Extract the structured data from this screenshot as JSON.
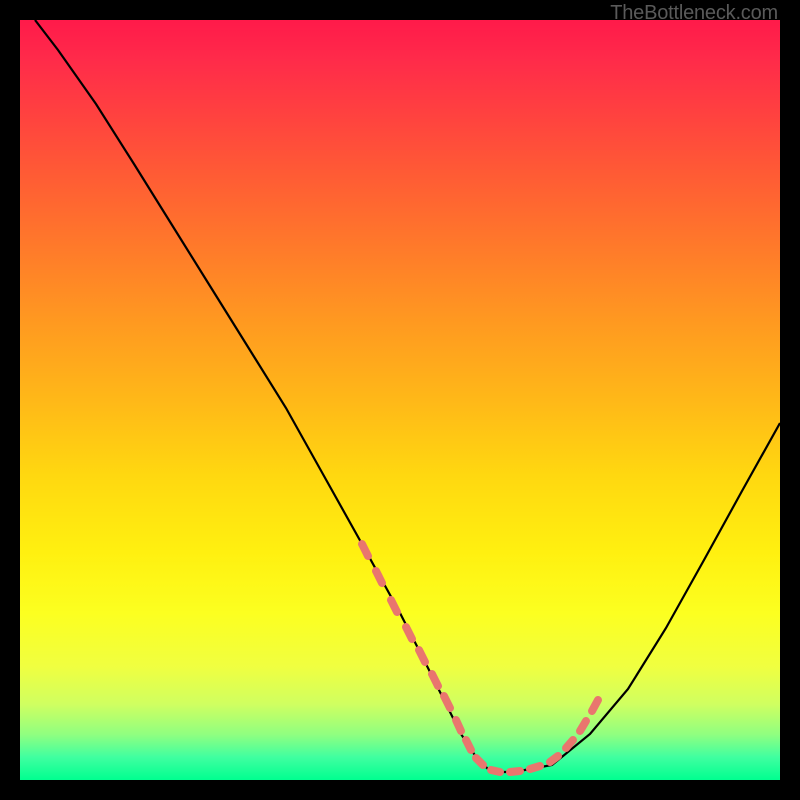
{
  "watermark": "TheBottleneck.com",
  "chart_data": {
    "type": "line",
    "title": "",
    "xlabel": "",
    "ylabel": "",
    "xlim": [
      0,
      100
    ],
    "ylim": [
      0,
      100
    ],
    "series": [
      {
        "name": "curve",
        "color": "#000000",
        "x": [
          2,
          5,
          10,
          15,
          20,
          25,
          30,
          35,
          40,
          45,
          50,
          53,
          56,
          58,
          60,
          62,
          65,
          70,
          75,
          80,
          85,
          90,
          95,
          100
        ],
        "y": [
          100,
          96,
          89,
          81,
          73,
          65,
          57,
          49,
          40,
          31,
          22,
          16,
          10,
          6,
          3,
          1,
          1,
          2,
          6,
          12,
          20,
          29,
          38,
          47
        ]
      },
      {
        "name": "dotted-highlight",
        "color": "#e9766e",
        "style": "dotted",
        "x": [
          45,
          47,
          49,
          51,
          53,
          55,
          56,
          58,
          59,
          60,
          61,
          62,
          63,
          64,
          65,
          66,
          68,
          70,
          72,
          74,
          76
        ],
        "y": [
          31,
          27,
          23,
          19,
          16,
          12,
          10,
          6,
          4,
          3,
          2,
          1,
          1,
          1,
          1,
          1,
          2,
          2,
          4,
          7,
          10
        ]
      }
    ],
    "background_gradient_note": "vertical gradient magenta-red → orange → yellow → green",
    "outer_background": "#000000"
  }
}
